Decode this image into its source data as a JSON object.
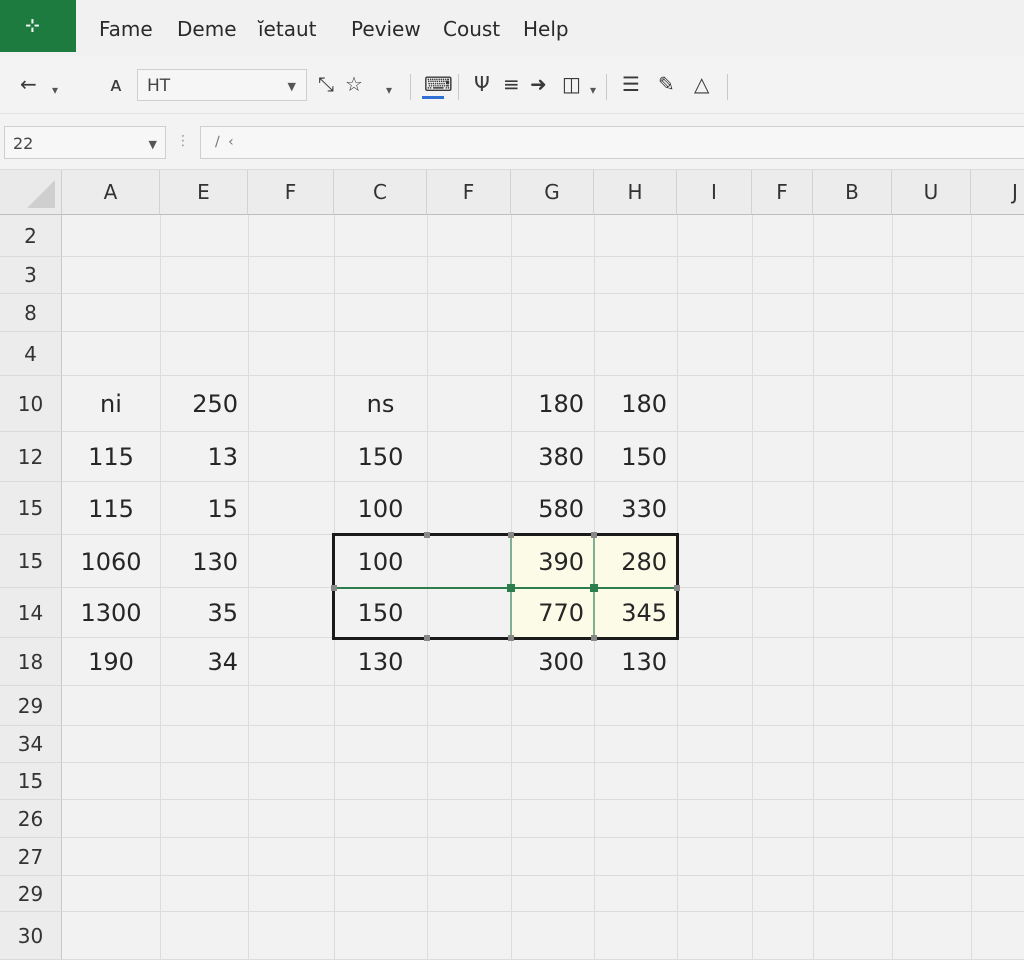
{
  "app": {
    "tile_label": "⊹"
  },
  "menu": [
    "Fame",
    "Deme",
    "ı̆etaut",
    "Peview",
    "Coust",
    "Help"
  ],
  "toolbar": {
    "font_name": "HT",
    "icons": [
      "back-arrow-icon",
      "font-a-icon",
      "pin-icon",
      "star-icon",
      "paint-bucket-icon",
      "psi-icon",
      "align-icon",
      "arrow-right-icon",
      "format-icon",
      "list-icon",
      "pen-icon",
      "triangle-icon"
    ]
  },
  "formula_bar": {
    "name_box": "22",
    "formula": "∕ ‹"
  },
  "grid": {
    "columns": [
      "A",
      "E",
      "F",
      "C",
      "F",
      "G",
      "H",
      "I",
      "F",
      "B",
      "U",
      "J"
    ],
    "rows": [
      "2",
      "3",
      "8",
      "4",
      "10",
      "12",
      "15",
      "15",
      "14",
      "18",
      "29",
      "34",
      "15",
      "26",
      "27",
      "29",
      "30"
    ],
    "cells": [
      {
        "row": 4,
        "col": 0,
        "value": "ni",
        "align": "c"
      },
      {
        "row": 4,
        "col": 1,
        "value": "250",
        "align": "r"
      },
      {
        "row": 4,
        "col": 3,
        "value": "ns",
        "align": "c"
      },
      {
        "row": 4,
        "col": 5,
        "value": "180",
        "align": "r"
      },
      {
        "row": 4,
        "col": 6,
        "value": "180",
        "align": "r"
      },
      {
        "row": 5,
        "col": 0,
        "value": "115",
        "align": "c"
      },
      {
        "row": 5,
        "col": 1,
        "value": "13",
        "align": "r"
      },
      {
        "row": 5,
        "col": 3,
        "value": "150",
        "align": "c"
      },
      {
        "row": 5,
        "col": 5,
        "value": "380",
        "align": "r"
      },
      {
        "row": 5,
        "col": 6,
        "value": "150",
        "align": "r"
      },
      {
        "row": 6,
        "col": 0,
        "value": "115",
        "align": "c"
      },
      {
        "row": 6,
        "col": 1,
        "value": "15",
        "align": "r"
      },
      {
        "row": 6,
        "col": 3,
        "value": "100",
        "align": "c"
      },
      {
        "row": 6,
        "col": 5,
        "value": "580",
        "align": "r"
      },
      {
        "row": 6,
        "col": 6,
        "value": "330",
        "align": "r"
      },
      {
        "row": 7,
        "col": 0,
        "value": "1060",
        "align": "c"
      },
      {
        "row": 7,
        "col": 1,
        "value": "130",
        "align": "r"
      },
      {
        "row": 7,
        "col": 3,
        "value": "100",
        "align": "c"
      },
      {
        "row": 7,
        "col": 5,
        "value": "390",
        "align": "r"
      },
      {
        "row": 7,
        "col": 6,
        "value": "280",
        "align": "r"
      },
      {
        "row": 8,
        "col": 0,
        "value": "1300",
        "align": "c"
      },
      {
        "row": 8,
        "col": 1,
        "value": "35",
        "align": "r"
      },
      {
        "row": 8,
        "col": 3,
        "value": "150",
        "align": "c"
      },
      {
        "row": 8,
        "col": 5,
        "value": "770",
        "align": "r"
      },
      {
        "row": 8,
        "col": 6,
        "value": "345",
        "align": "r"
      },
      {
        "row": 9,
        "col": 0,
        "value": "190",
        "align": "c"
      },
      {
        "row": 9,
        "col": 1,
        "value": "34",
        "align": "r"
      },
      {
        "row": 9,
        "col": 3,
        "value": "130",
        "align": "c"
      },
      {
        "row": 9,
        "col": 5,
        "value": "300",
        "align": "r"
      },
      {
        "row": 9,
        "col": 6,
        "value": "130",
        "align": "r"
      }
    ],
    "highlight_color": "#fbfbe7",
    "accent_color": "#1e7b40"
  }
}
